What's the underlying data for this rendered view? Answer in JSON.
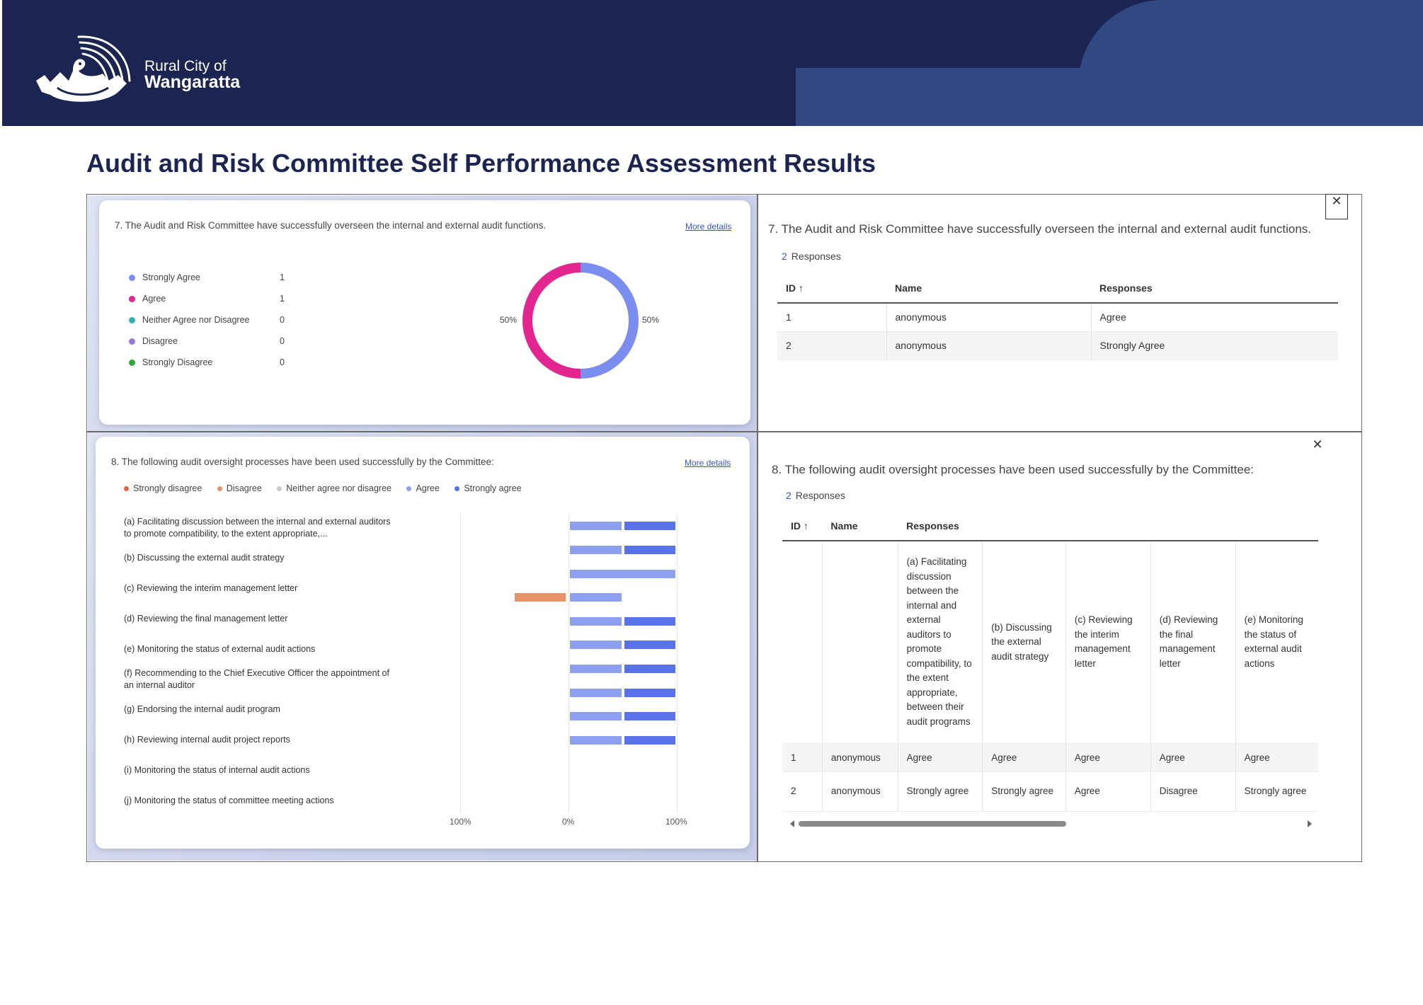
{
  "header": {
    "org_line1": "Rural City of",
    "org_line2": "Wangaratta"
  },
  "page_title": "Audit and Risk Committee Self Performance Assessment Results",
  "q7_chart": {
    "question": "7. The Audit and Risk Committee have successfully overseen the internal and external audit functions.",
    "more_details": "More details",
    "legend": [
      {
        "label": "Strongly Agree",
        "count": "1",
        "color": "#7b8ef0"
      },
      {
        "label": "Agree",
        "count": "1",
        "color": "#e3268f"
      },
      {
        "label": "Neither Agree nor Disagree",
        "count": "0",
        "color": "#2fb2b3"
      },
      {
        "label": "Disagree",
        "count": "0",
        "color": "#9a78d6"
      },
      {
        "label": "Strongly Disagree",
        "count": "0",
        "color": "#2ea83a"
      }
    ],
    "pct_left": "50%",
    "pct_right": "50%"
  },
  "q7_table": {
    "question": "7. The Audit and Risk Committee have successfully overseen the internal and external audit functions.",
    "responses_count": "2",
    "responses_label": "Responses",
    "columns": [
      "ID ↑",
      "Name",
      "Responses"
    ],
    "rows": [
      [
        "1",
        "anonymous",
        "Agree"
      ],
      [
        "2",
        "anonymous",
        "Strongly Agree"
      ]
    ],
    "close": "✕"
  },
  "q8_chart": {
    "question": "8. The following audit oversight processes have been used successfully by the Committee:",
    "more_details": "More details",
    "legend": [
      {
        "label": "Strongly disagree",
        "color": "#e0653a"
      },
      {
        "label": "Disagree",
        "color": "#e8926a"
      },
      {
        "label": "Neither agree nor disagree",
        "color": "#c9c9c9"
      },
      {
        "label": "Agree",
        "color": "#8f9ff0"
      },
      {
        "label": "Strongly agree",
        "color": "#5a72e8"
      }
    ],
    "rows": [
      "(a) Facilitating discussion between the internal and external auditors to promote compatibility, to the extent appropriate,...",
      "(b) Discussing the external audit strategy",
      "(c) Reviewing the interim management letter",
      "(d) Reviewing the final management letter",
      "(e) Monitoring the status of external audit actions",
      "(f) Recommending to the Chief Executive Officer the appointment of an internal auditor",
      "(g) Endorsing the internal audit program",
      "(h) Reviewing internal audit project reports",
      "(i) Monitoring the status of internal audit actions",
      "(j) Monitoring the status of committee meeting actions"
    ],
    "axis_labels": [
      "100%",
      "0%",
      "100%"
    ]
  },
  "chart_data": [
    {
      "type": "pie",
      "title": "7. The Audit and Risk Committee have successfully overseen the internal and external audit functions.",
      "categories": [
        "Strongly Agree",
        "Agree",
        "Neither Agree nor Disagree",
        "Disagree",
        "Strongly Disagree"
      ],
      "values": [
        1,
        1,
        0,
        0,
        0
      ],
      "labels": [
        "50%",
        "50%"
      ],
      "donut": true
    },
    {
      "type": "bar",
      "orientation": "horizontal",
      "stacked": "diverging",
      "title": "8. The following audit oversight processes have been used successfully by the Committee:",
      "categories": [
        "(a)",
        "(b)",
        "(c)",
        "(d)",
        "(e)",
        "(f)",
        "(g)",
        "(h)",
        "(i)",
        "(j)"
      ],
      "series": [
        {
          "name": "Strongly disagree",
          "values": [
            0,
            0,
            0,
            0,
            0,
            0,
            0,
            0,
            0,
            0
          ]
        },
        {
          "name": "Disagree",
          "values": [
            0,
            0,
            0,
            1,
            0,
            0,
            0,
            0,
            0,
            0
          ]
        },
        {
          "name": "Neither agree nor disagree",
          "values": [
            0,
            0,
            0,
            0,
            0,
            0,
            0,
            0,
            0,
            0
          ]
        },
        {
          "name": "Agree",
          "values": [
            1,
            1,
            2,
            1,
            1,
            1,
            1,
            1,
            1,
            1
          ]
        },
        {
          "name": "Strongly agree",
          "values": [
            1,
            1,
            0,
            0,
            1,
            1,
            1,
            1,
            1,
            1
          ]
        }
      ],
      "xlim": [
        -100,
        100
      ],
      "xticks": [
        "100%",
        "0%",
        "100%"
      ]
    }
  ],
  "q8_table": {
    "question": "8. The following audit oversight processes have been used successfully by the Committee:",
    "responses_count": "2",
    "responses_label": "Responses",
    "columns": [
      "ID ↑",
      "Name",
      "Responses"
    ],
    "subheaders": [
      "(a) Facilitating discussion between the internal and external auditors to promote compatibility, to the extent appropriate, between their audit programs",
      "(b) Discussing the external audit strategy",
      "(c) Reviewing the interim management letter",
      "(d) Reviewing the final management letter",
      "(e) Monitoring the status of external audit actions"
    ],
    "rows": [
      [
        "1",
        "anonymous",
        "Agree",
        "Agree",
        "Agree",
        "Agree",
        "Agree"
      ],
      [
        "2",
        "anonymous",
        "Strongly agree",
        "Strongly agree",
        "Agree",
        "Disagree",
        "Strongly agree"
      ]
    ],
    "close": "✕"
  }
}
